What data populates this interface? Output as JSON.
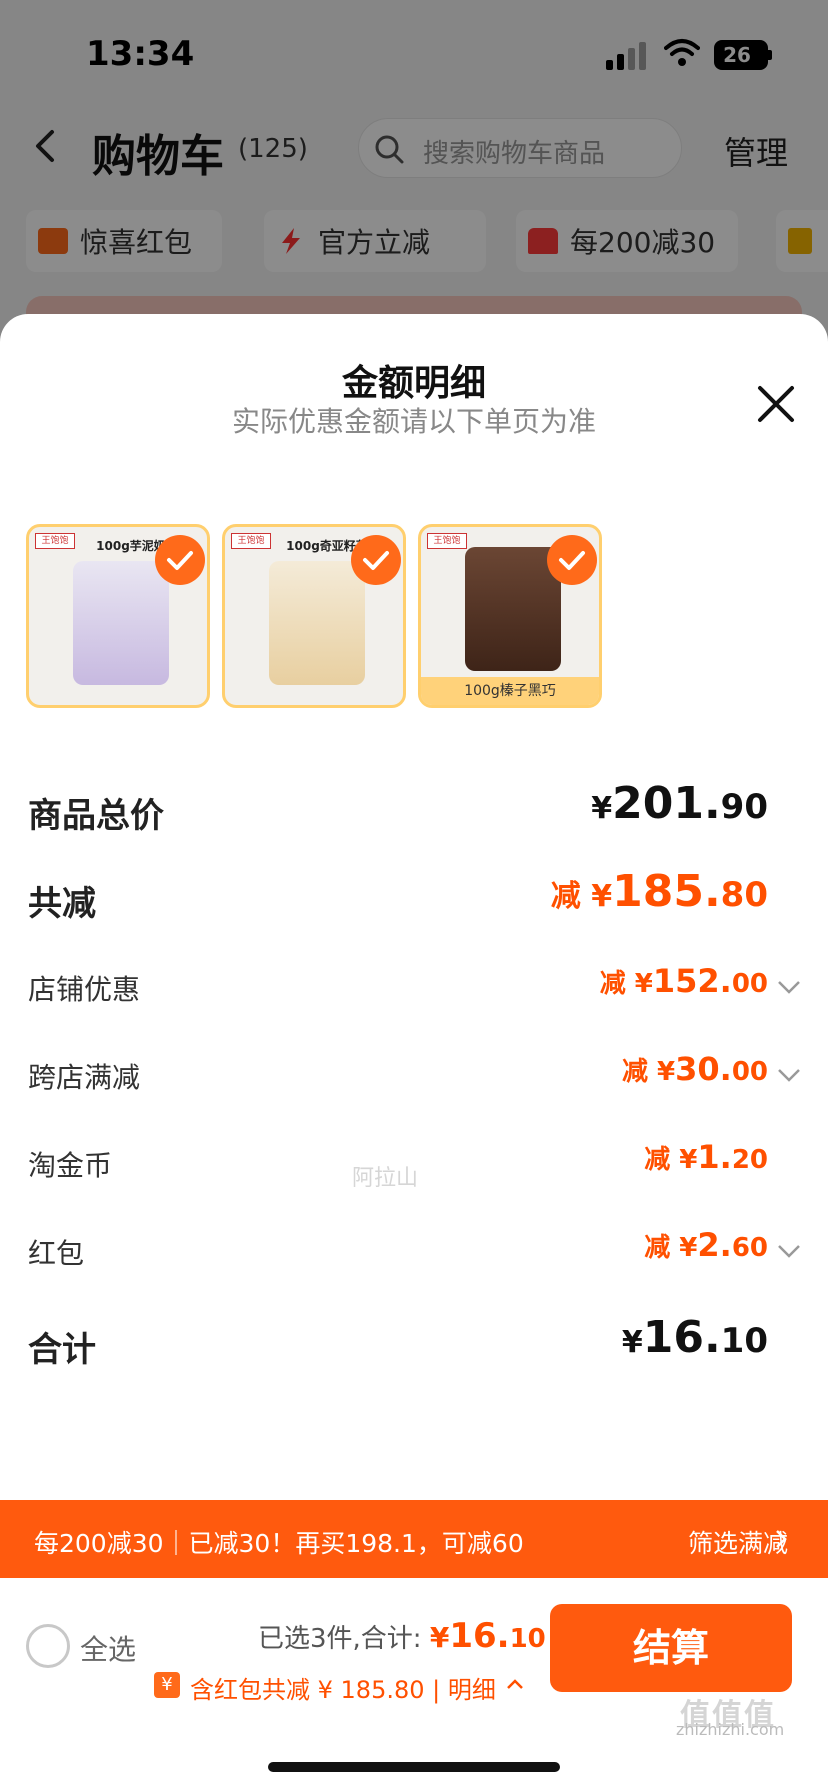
{
  "status_bar": {
    "time": "13:34",
    "battery": "26"
  },
  "nav": {
    "title": "购物车",
    "count": "(125)",
    "search_placeholder": "搜索购物车商品",
    "manage": "管理"
  },
  "chips": [
    "惊喜红包",
    "官方立减",
    "每200减30"
  ],
  "sheet": {
    "title": "金额明细",
    "subtitle": "实际优惠金额请以下单页为准",
    "products": [
      {
        "title": "100g芋泥奶茶",
        "bag_color": "#cfc2e6",
        "caption": ""
      },
      {
        "title": "100g奇亚籽草莓",
        "bag_color": "#f3e0b8",
        "caption": ""
      },
      {
        "title": "",
        "bag_color": "#5a3a2a",
        "caption": "100g榛子黑巧"
      }
    ],
    "rows": [
      {
        "label": "商品总价",
        "prefix": "",
        "cur": "¥",
        "int": "201.",
        "dec": "90",
        "style": "big",
        "color": "black",
        "chevron": false
      },
      {
        "label": "共减",
        "prefix": "减 ",
        "cur": "¥",
        "int": "185.",
        "dec": "80",
        "style": "big",
        "color": "orange",
        "chevron": false
      },
      {
        "label": "店铺优惠",
        "prefix": "减 ",
        "cur": "¥",
        "int": "152.",
        "dec": "00",
        "style": "small",
        "color": "orange",
        "chevron": true
      },
      {
        "label": "跨店满减",
        "prefix": "减 ",
        "cur": "¥",
        "int": "30.",
        "dec": "00",
        "style": "small",
        "color": "orange",
        "chevron": true
      },
      {
        "label": "淘金币",
        "prefix": "减 ",
        "cur": "¥",
        "int": "1.",
        "dec": "20",
        "style": "small",
        "color": "orange",
        "chevron": false
      },
      {
        "label": "红包",
        "prefix": "减 ",
        "cur": "¥",
        "int": "2.",
        "dec": "60",
        "style": "small",
        "color": "orange",
        "chevron": true
      },
      {
        "label": "合计",
        "prefix": "",
        "cur": "¥",
        "int": "16.",
        "dec": "10",
        "style": "big",
        "color": "black",
        "chevron": false
      }
    ],
    "watermark": "阿拉山"
  },
  "promo": {
    "left": "每200减30｜已减30！再买198.1，可减60",
    "right": "筛选满减"
  },
  "checkout": {
    "select_all": "全选",
    "chosen": "已选3件,合计:",
    "total_cur": "¥",
    "total_int": "16.",
    "total_dec": "10",
    "discount_icon": "¥",
    "discount": "含红包共减 ¥ 185.80 | 明细",
    "pay": "结算"
  },
  "site": {
    "logo": "值值值",
    "url": "zhizhizhi.com"
  },
  "colors": {
    "accent": "#ff5000",
    "button": "#ff5a0e"
  }
}
